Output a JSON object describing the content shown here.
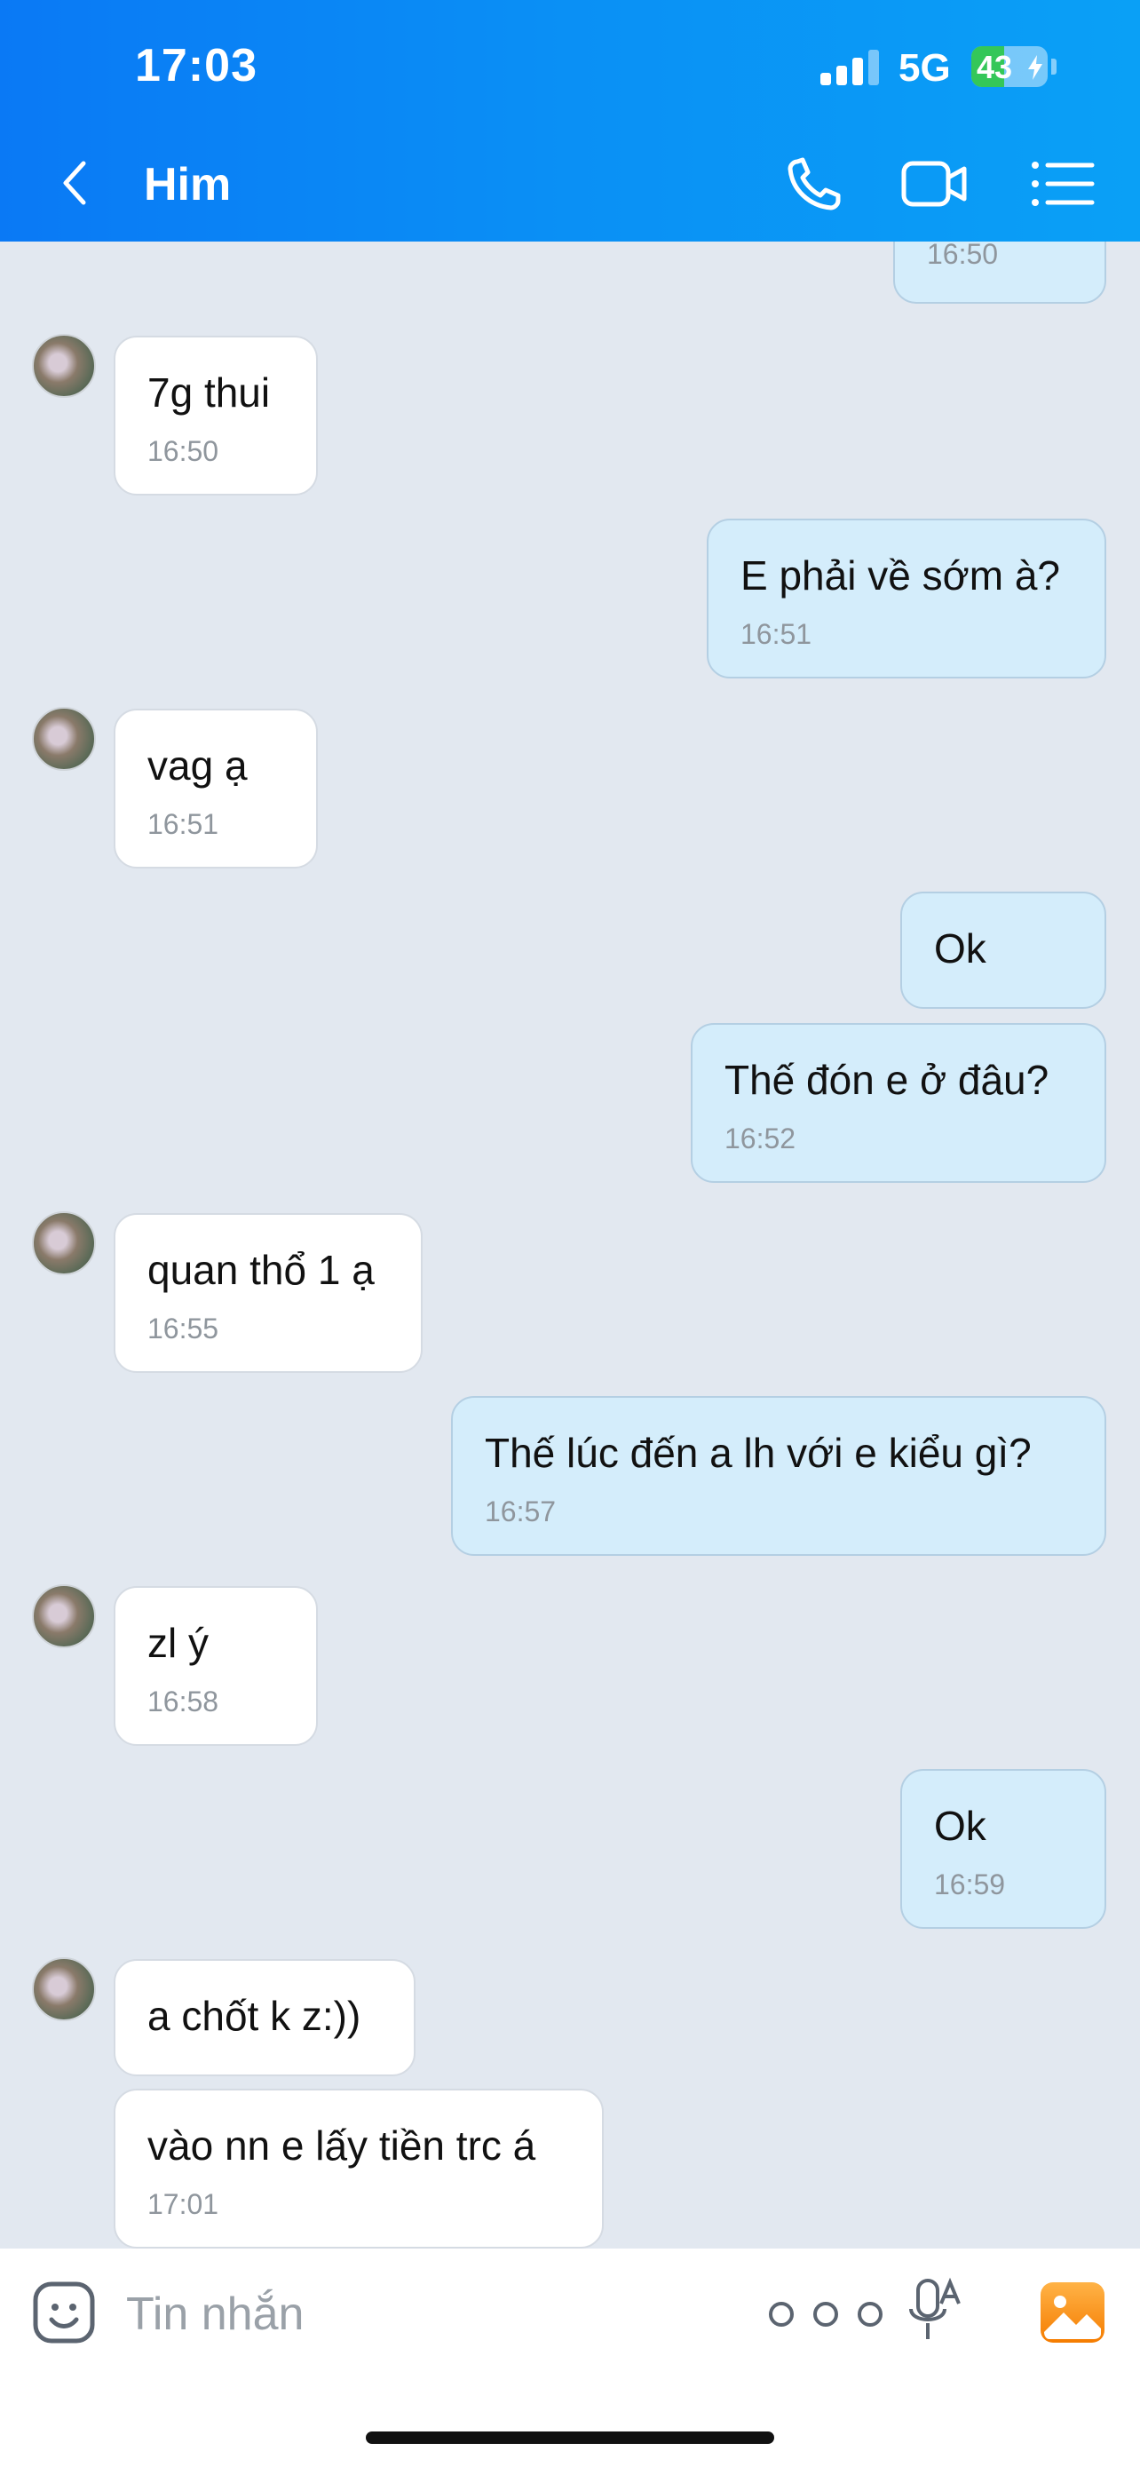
{
  "status_bar": {
    "time": "17:03",
    "network": "5G",
    "battery": "43",
    "battery_level": 0.43
  },
  "header": {
    "title": "Him",
    "back_icon": "chevron-left-icon",
    "call_icon": "phone-icon",
    "video_icon": "video-call-icon",
    "menu_icon": "list-icon"
  },
  "messages": [
    {
      "side": "out",
      "text": "",
      "time": "16:50"
    },
    {
      "side": "in",
      "text": "7g thui",
      "time": "16:50"
    },
    {
      "side": "out",
      "text": "E phải về sớm à?",
      "time": "16:51"
    },
    {
      "side": "in",
      "text": "vag ạ",
      "time": "16:51"
    },
    {
      "side": "out",
      "text": "Ok",
      "time": ""
    },
    {
      "side": "out",
      "text": "Thế đón e ở đâu?",
      "time": "16:52"
    },
    {
      "side": "in",
      "text": "quan thổ 1 ạ",
      "time": "16:55"
    },
    {
      "side": "out",
      "text": "Thế lúc đến a lh với e kiểu gì?",
      "time": "16:57"
    },
    {
      "side": "in",
      "text": "zl ý",
      "time": "16:58"
    },
    {
      "side": "out",
      "text": "Ok",
      "time": "16:59"
    },
    {
      "side": "in",
      "text": "a chốt k z:))",
      "time": ""
    },
    {
      "side": "in",
      "text": "vào nn e lấy tiền trc á",
      "time": "17:01"
    }
  ],
  "composer": {
    "placeholder": "Tin nhắn",
    "sticker_icon": "sticker-icon",
    "more_icon": "more-options-icon",
    "mic_icon": "voice-to-text-icon",
    "gallery_icon": "gallery-icon"
  }
}
